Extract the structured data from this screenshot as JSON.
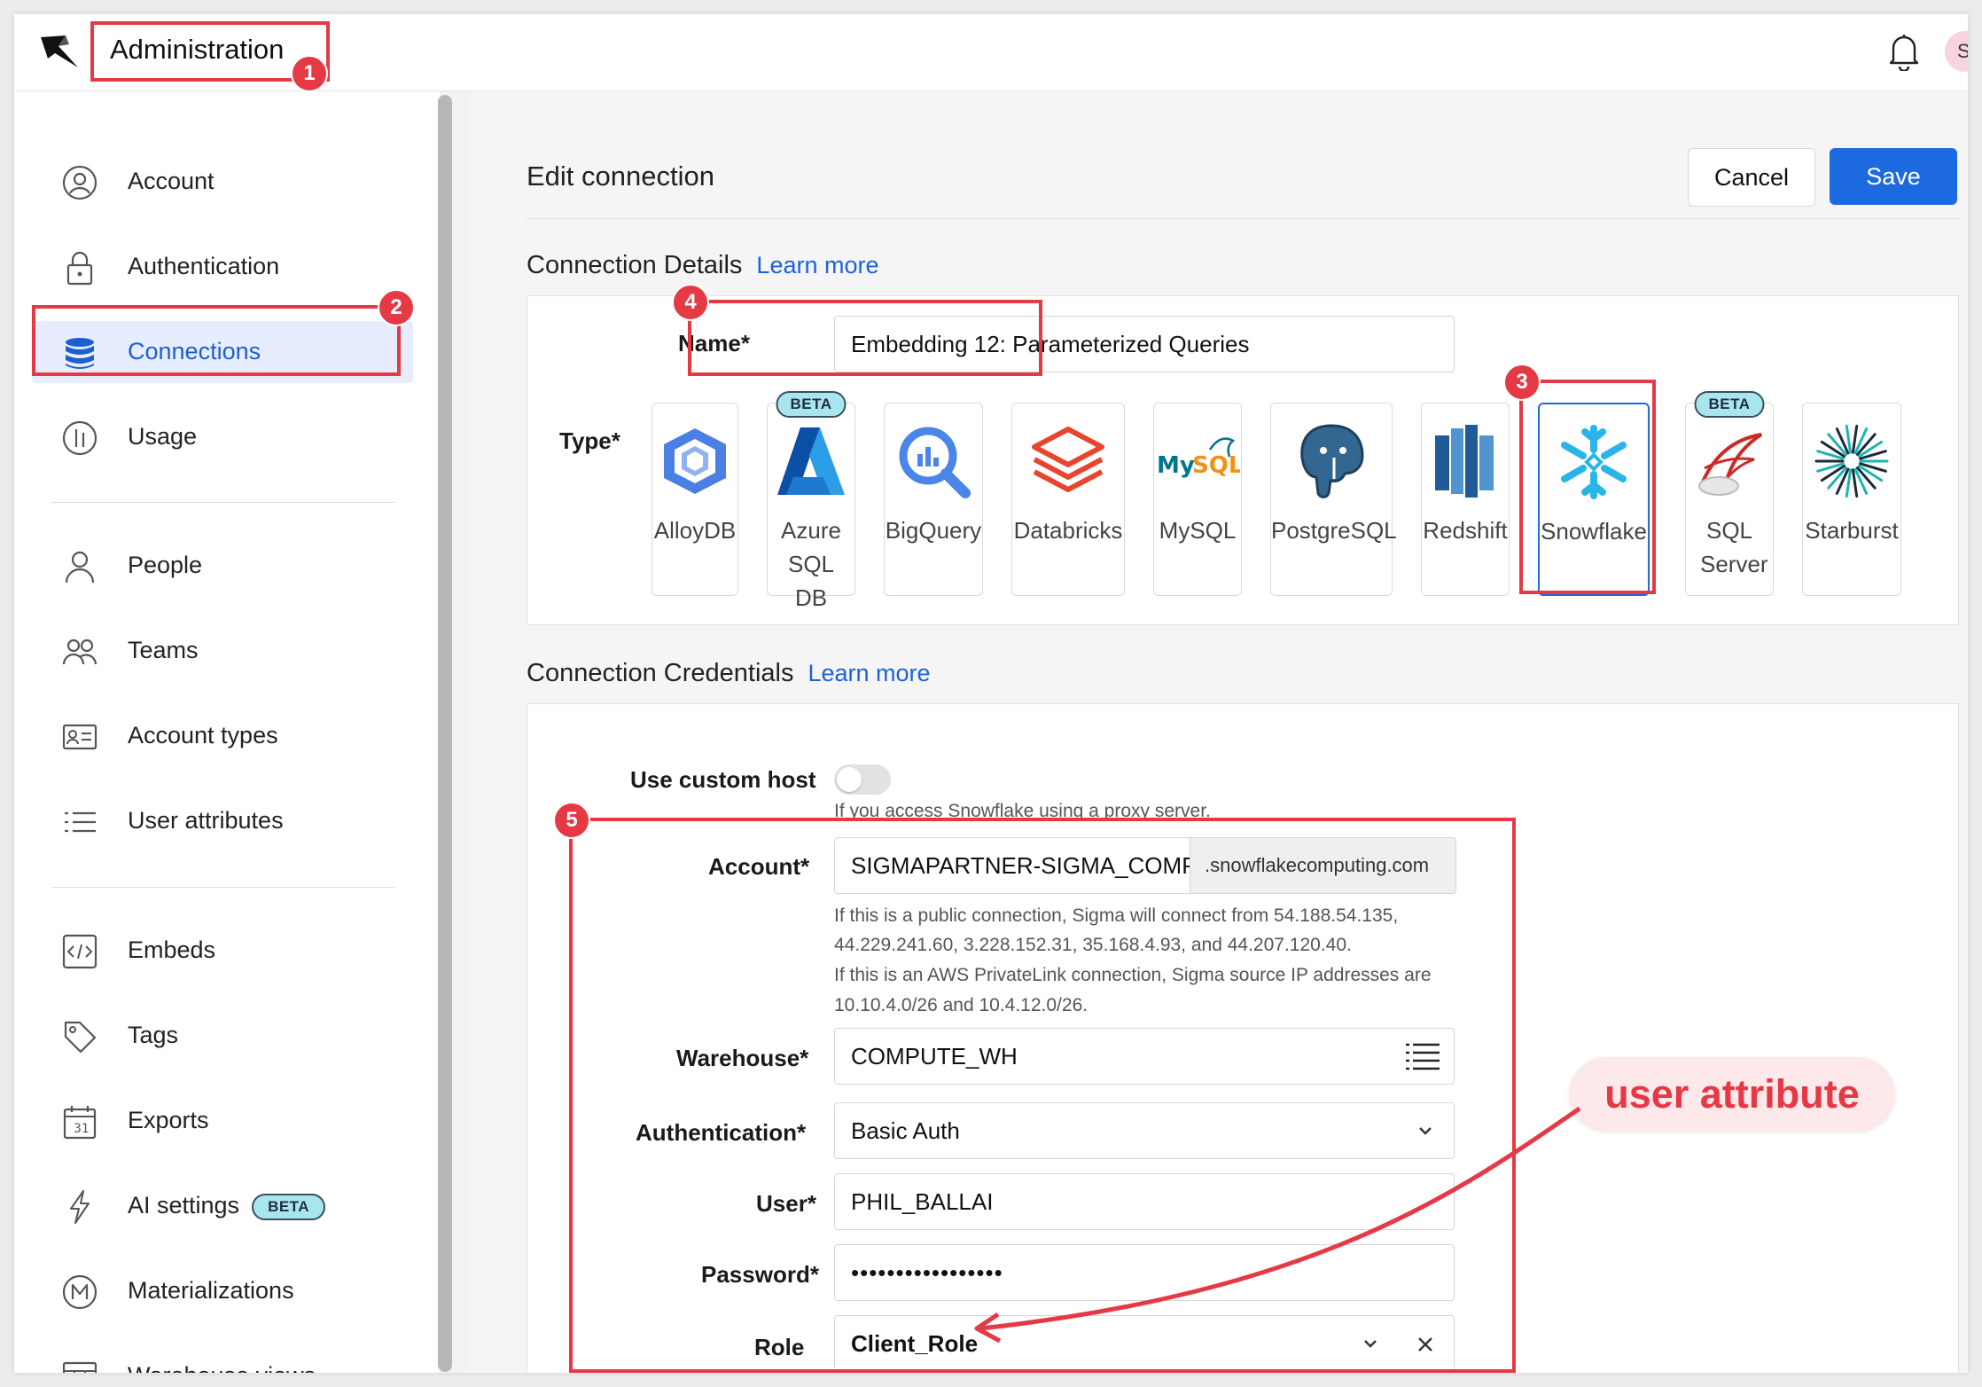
{
  "header": {
    "title": "Administration",
    "avatar_initial": "S"
  },
  "sidebar": {
    "items": [
      {
        "label": "Account",
        "icon": "user-circle-icon"
      },
      {
        "label": "Authentication",
        "icon": "lock-icon"
      },
      {
        "label": "Connections",
        "icon": "database-icon",
        "active": true
      },
      {
        "label": "Usage",
        "icon": "usage-icon"
      },
      {
        "label": "People",
        "icon": "person-icon"
      },
      {
        "label": "Teams",
        "icon": "team-icon"
      },
      {
        "label": "Account types",
        "icon": "id-card-icon"
      },
      {
        "label": "User attributes",
        "icon": "list-icon"
      },
      {
        "label": "Embeds",
        "icon": "code-icon"
      },
      {
        "label": "Tags",
        "icon": "tag-icon"
      },
      {
        "label": "Exports",
        "icon": "calendar-icon"
      },
      {
        "label": "AI settings",
        "icon": "lightning-icon",
        "badge": "BETA"
      },
      {
        "label": "Materializations",
        "icon": "materialization-icon"
      },
      {
        "label": "Warehouse views",
        "icon": "table-icon"
      }
    ]
  },
  "page": {
    "title": "Edit connection",
    "cancel_label": "Cancel",
    "save_label": "Save"
  },
  "details": {
    "section_title": "Connection Details",
    "learn_more": "Learn more",
    "name_label": "Name*",
    "name_value": "Embedding 12: Parameterized Queries",
    "type_label": "Type*",
    "types": [
      {
        "label": "AlloyDB"
      },
      {
        "label": "Azure SQL DB",
        "badge": "BETA"
      },
      {
        "label": "BigQuery"
      },
      {
        "label": "Databricks"
      },
      {
        "label": "MySQL"
      },
      {
        "label": "PostgreSQL"
      },
      {
        "label": "Redshift"
      },
      {
        "label": "Snowflake",
        "selected": true
      },
      {
        "label": "SQL Server",
        "badge": "BETA"
      },
      {
        "label": "Starburst"
      }
    ]
  },
  "credentials": {
    "section_title": "Connection Credentials",
    "learn_more": "Learn more",
    "custom_host_label": "Use custom host",
    "custom_host_help": "If you access Snowflake using a proxy server.",
    "account_label": "Account*",
    "account_value": "SIGMAPARTNER-SIGMA_COMPU",
    "account_suffix": ".snowflakecomputing.com",
    "account_help_1": "If this is a public connection, Sigma will connect from 54.188.54.135,",
    "account_help_2": "44.229.241.60, 3.228.152.31, 35.168.4.93, and 44.207.120.40.",
    "account_help_3": "If this is an AWS PrivateLink connection, Sigma source IP addresses are",
    "account_help_4": "10.10.4.0/26 and 10.4.12.0/26.",
    "warehouse_label": "Warehouse*",
    "warehouse_value": "COMPUTE_WH",
    "auth_label": "Authentication*",
    "auth_value": "Basic Auth",
    "user_label": "User*",
    "user_value": "PHIL_BALLAI",
    "password_label": "Password*",
    "password_value": "•••••••••••••••••",
    "role_label": "Role",
    "role_value": "Client_Role"
  },
  "annotations": {
    "numbers": [
      "1",
      "2",
      "3",
      "4",
      "5"
    ],
    "callout": "user attribute",
    "color": "#e63946"
  },
  "colors": {
    "accent": "#1d6ae0",
    "active_nav_bg": "#e6edfc",
    "beta_bg": "#a9e5ee"
  }
}
